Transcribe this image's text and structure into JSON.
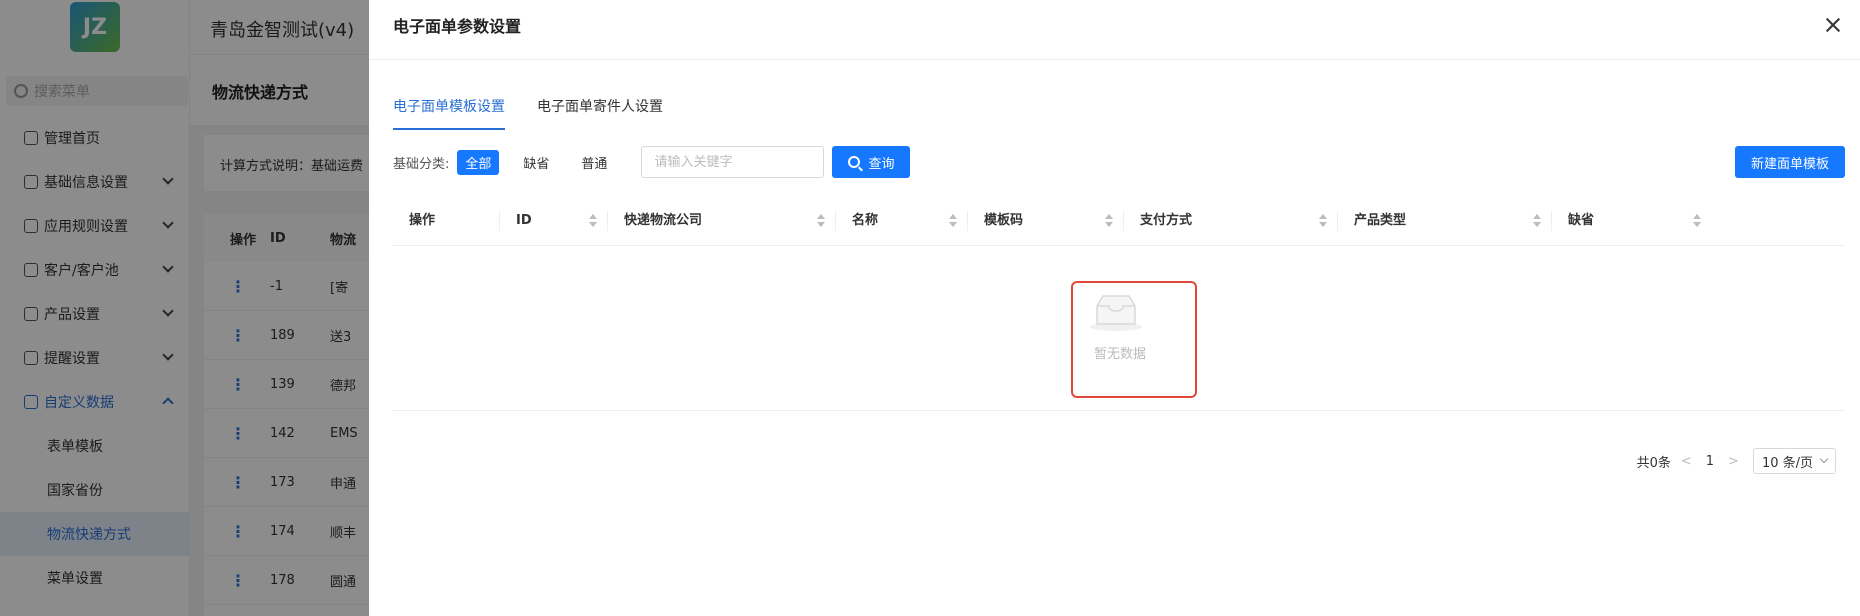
{
  "app": {
    "title": "青岛金智测试(v4)",
    "logo_text": "JZ"
  },
  "sidebar": {
    "search_placeholder": "搜索菜单",
    "items": [
      {
        "label": "管理首页",
        "has_chevron": false
      },
      {
        "label": "基础信息设置",
        "has_chevron": true
      },
      {
        "label": "应用规则设置",
        "has_chevron": true
      },
      {
        "label": "客户/客户池",
        "has_chevron": true
      },
      {
        "label": "产品设置",
        "has_chevron": true
      },
      {
        "label": "提醒设置",
        "has_chevron": true
      },
      {
        "label": "自定义数据",
        "has_chevron": true,
        "expanded": true
      }
    ],
    "sub_items": [
      {
        "label": "表单模板"
      },
      {
        "label": "国家省份"
      },
      {
        "label": "物流快递方式",
        "selected": true
      },
      {
        "label": "菜单设置"
      }
    ]
  },
  "page": {
    "title": "物流快递方式",
    "explain_text": "计算方式说明：基础运费",
    "table_headers": [
      "操作",
      "ID",
      "物流"
    ],
    "rows": [
      {
        "id": "-1",
        "name": "[寄"
      },
      {
        "id": "189",
        "name": "送3"
      },
      {
        "id": "139",
        "name": "德邦"
      },
      {
        "id": "142",
        "name": "EMS"
      },
      {
        "id": "173",
        "name": "申通"
      },
      {
        "id": "174",
        "name": "顺丰"
      },
      {
        "id": "178",
        "name": "圆通"
      }
    ]
  },
  "drawer": {
    "title": "电子面单参数设置",
    "tabs": [
      {
        "label": "电子面单模板设置",
        "active": true
      },
      {
        "label": "电子面单寄件人设置",
        "active": false
      }
    ],
    "filter": {
      "label": "基础分类:",
      "chips": [
        {
          "label": "全部",
          "active": true
        },
        {
          "label": "缺省",
          "active": false
        },
        {
          "label": "普通",
          "active": false
        }
      ],
      "keyword_placeholder": "请输入关键字",
      "keyword_value": "",
      "query_label": "查询",
      "new_label": "新建面单模板"
    },
    "table": {
      "columns": [
        "操作",
        "ID",
        "快递物流公司",
        "名称",
        "模板码",
        "支付方式",
        "产品类型",
        "缺省"
      ],
      "empty_text": "暂无数据"
    },
    "pagination": {
      "total_text": "共0条",
      "current_page": "1",
      "page_size": "10 条/页"
    }
  },
  "colors": {
    "primary": "#1677ff",
    "highlight": "#e0483a"
  }
}
